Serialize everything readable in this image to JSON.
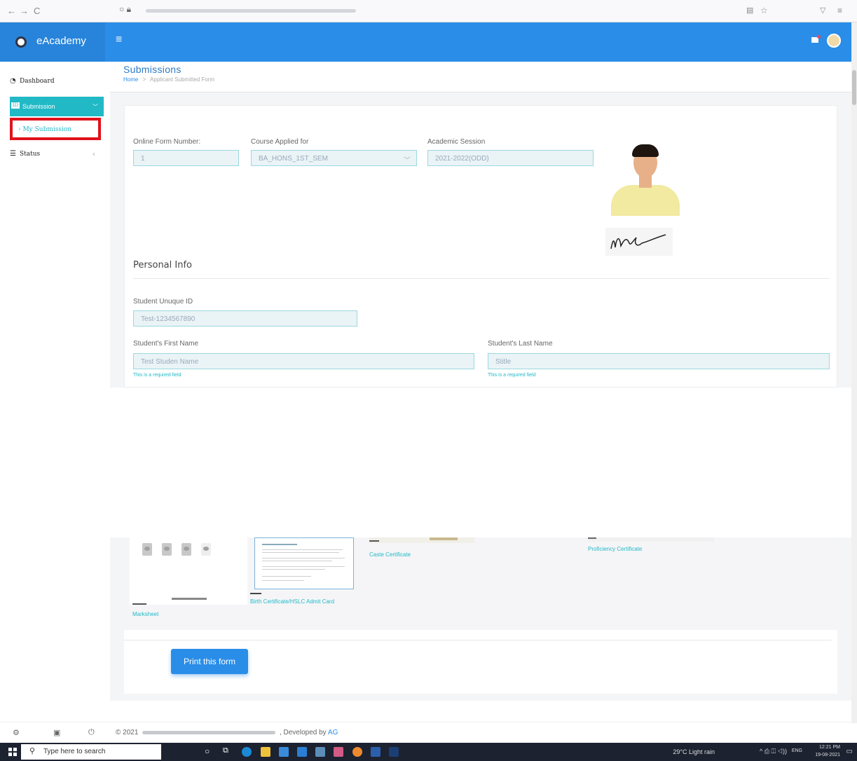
{
  "browser": {
    "back": "←",
    "forward": "→",
    "reload": "C",
    "icons": [
      "reader-icon",
      "star-icon",
      "pocket-icon",
      "menu-icon"
    ]
  },
  "app": {
    "brand": "eAcademy",
    "menu_glyph": "≡"
  },
  "sidebar": {
    "dashboard": "Dashboard",
    "submission": "Submission",
    "my_submission": "› My Submission",
    "status": "Status"
  },
  "page": {
    "title": "Submissions",
    "breadcrumb_home": "Home",
    "breadcrumb_sep": ">",
    "breadcrumb_current": "Applicant Submitted Form"
  },
  "form": {
    "online_form_number_label": "Online Form Number:",
    "online_form_number_value": "1",
    "course_label": "Course Applied for",
    "course_value": "BA_HONS_1ST_SEM",
    "session_label": "Academic Session",
    "session_value": "2021-2022(ODD)",
    "personal_info_title": "Personal Info",
    "unique_id_label": "Student Unuque ID",
    "unique_id_value": "Test-1234567890",
    "first_name_label": "Student's First Name",
    "first_name_value": "Test Studen Name",
    "last_name_label": "Student's Last Name",
    "last_name_value": "Stitle",
    "required_hint": "This is a required field"
  },
  "documents": {
    "marksheet": "Marksheet",
    "birth_certificate": "Birth Certificate/HSLC Admit Card",
    "caste_certificate": "Caste Certificate",
    "proficiency_certificate": "Proficiency Certificate"
  },
  "actions": {
    "print": "Print this form"
  },
  "footer": {
    "copyright": "© 2021",
    "developed_by": ", Developed by ",
    "developer": "AG"
  },
  "taskbar": {
    "search_placeholder": "Type here to search",
    "weather": "29°C Light rain",
    "language": "ENG",
    "time": "12:21 PM",
    "date": "19-08-2021"
  },
  "colors": {
    "header_blue": "#2a8de8",
    "accent_teal": "#21b9c6",
    "highlight_red": "#e0121c"
  }
}
